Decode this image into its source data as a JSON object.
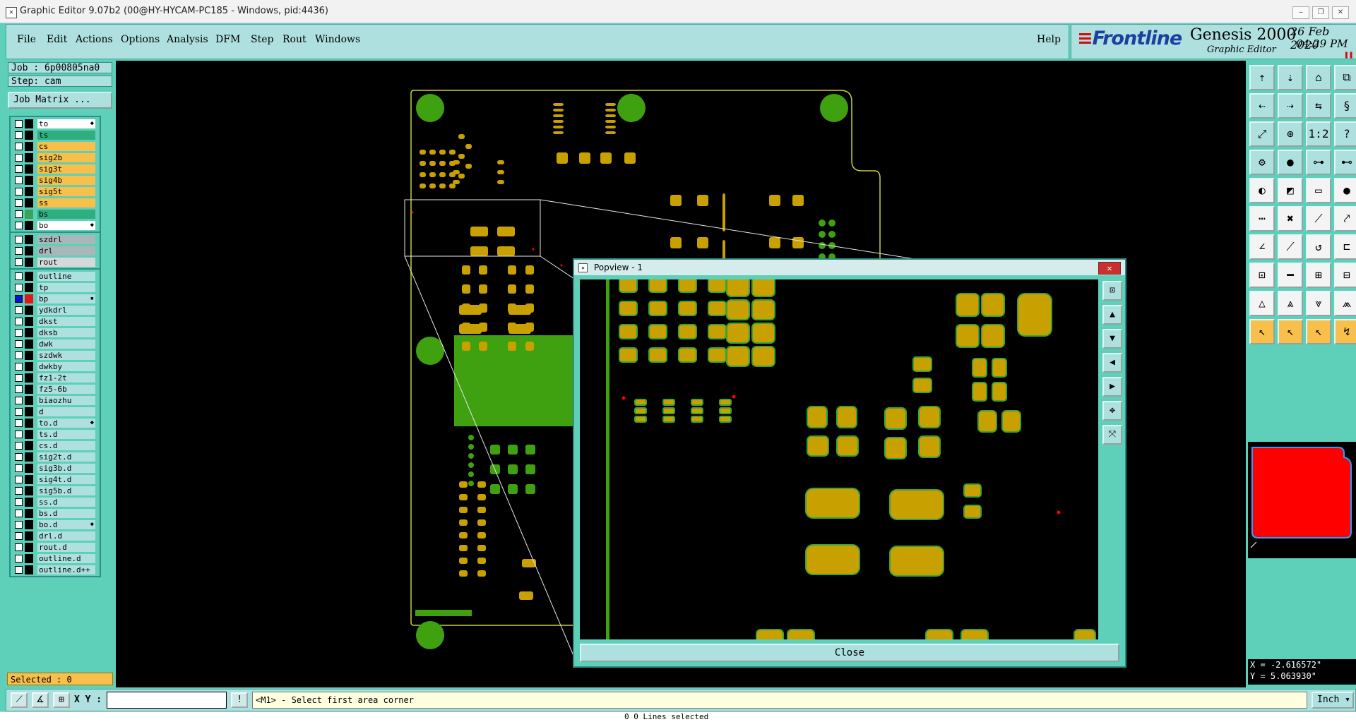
{
  "window": {
    "title": "Graphic Editor 9.07b2 (00@HY-HYCAM-PC185 - Windows, pid:4436)",
    "minimize": "‒",
    "restore": "❐",
    "close": "✕"
  },
  "menu": {
    "items": [
      "File",
      "Edit",
      "Actions",
      "Options",
      "Analysis",
      "DFM",
      "Step",
      "Rout",
      "Windows"
    ],
    "help": "Help"
  },
  "brand": {
    "logo": "Frontline",
    "product": "Genesis 2000",
    "subtitle": "Graphic Editor",
    "date": "26 Feb 2020",
    "time": "04:29 PM",
    "pause": "❚❚"
  },
  "left": {
    "job": "Job : 6p00805na0",
    "step": "Step: cam",
    "job_matrix": "Job Matrix ..."
  },
  "layers": {
    "group1": [
      {
        "name": "to",
        "color": "#ffffff",
        "mark": "◆"
      },
      {
        "name": "ts",
        "color": "#2fae80"
      },
      {
        "name": "cs",
        "color": "#f8c04a"
      },
      {
        "name": "sig2b",
        "color": "#f8c04a"
      },
      {
        "name": "sig3t",
        "color": "#f8c04a"
      },
      {
        "name": "sig4b",
        "color": "#f8c04a"
      },
      {
        "name": "sig5t",
        "color": "#f8c04a"
      },
      {
        "name": "ss",
        "color": "#f8c04a"
      },
      {
        "name": "bs",
        "color": "#2fae80",
        "active": "green"
      },
      {
        "name": "bo",
        "color": "#ffffff",
        "mark": "◆"
      }
    ],
    "group2": [
      {
        "name": "szdrl",
        "color": "#a8b8b8"
      },
      {
        "name": "drl",
        "color": "#a8b8b8"
      },
      {
        "name": "rout",
        "color": "#d8d8d8"
      }
    ],
    "group3": [
      {
        "name": "outline",
        "color": "#aee0e0"
      },
      {
        "name": "tp",
        "color": "#aee0e0"
      },
      {
        "name": "bp",
        "color": "#aee0e0",
        "active": "red",
        "checked": true,
        "mark": "▪"
      },
      {
        "name": "ydkdrl",
        "color": "#aee0e0"
      },
      {
        "name": "dkst",
        "color": "#aee0e0"
      },
      {
        "name": "dksb",
        "color": "#aee0e0"
      },
      {
        "name": "dwk",
        "color": "#aee0e0"
      },
      {
        "name": "szdwk",
        "color": "#aee0e0"
      },
      {
        "name": "dwkby",
        "color": "#aee0e0"
      },
      {
        "name": "fz1-2t",
        "color": "#aee0e0"
      },
      {
        "name": "fz5-6b",
        "color": "#aee0e0"
      },
      {
        "name": "biaozhu",
        "color": "#aee0e0"
      },
      {
        "name": "d",
        "color": "#aee0e0"
      },
      {
        "name": "to.d",
        "color": "#aee0e0",
        "mark": "◆"
      },
      {
        "name": "ts.d",
        "color": "#aee0e0"
      },
      {
        "name": "cs.d",
        "color": "#aee0e0"
      },
      {
        "name": "sig2t.d",
        "color": "#aee0e0"
      },
      {
        "name": "sig3b.d",
        "color": "#aee0e0"
      },
      {
        "name": "sig4t.d",
        "color": "#aee0e0"
      },
      {
        "name": "sig5b.d",
        "color": "#aee0e0"
      },
      {
        "name": "ss.d",
        "color": "#aee0e0"
      },
      {
        "name": "bs.d",
        "color": "#aee0e0"
      },
      {
        "name": "bo.d",
        "color": "#aee0e0",
        "mark": "◆"
      },
      {
        "name": "drl.d",
        "color": "#aee0e0"
      },
      {
        "name": "rout.d",
        "color": "#aee0e0"
      },
      {
        "name": "outline.d",
        "color": "#aee0e0"
      },
      {
        "name": "outline.d++",
        "color": "#aee0e0"
      }
    ]
  },
  "selected": "Selected : 0",
  "coords": {
    "x": "X = -2.616572\"",
    "y": "Y = 5.063930\""
  },
  "command": {
    "xy_label": "X Y :",
    "xy_value": "",
    "prompt": "<M1> - Select first area corner",
    "units": "Inch"
  },
  "status": "0 0 Lines selected",
  "popview": {
    "title": "Popview - 1",
    "close_label": "Close",
    "close_x": "✕"
  },
  "colors": {
    "pad": "#c8a000",
    "pad_stroke": "#3aa335",
    "mask": "#3fa010",
    "outline": "#c8d040",
    "zoom_box": "#e8e8e8",
    "highlight": "#ff0000"
  }
}
